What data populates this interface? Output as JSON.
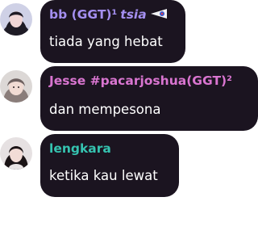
{
  "messages": [
    {
      "name": "bb (GGT)¹",
      "tag": "tsia",
      "name_color": "#a48ff0",
      "text": "tiada yang hebat",
      "flag_icon": "flag-badge-icon"
    },
    {
      "name": "Jesse #pacarjoshua(GGT)²",
      "name_color": "#d975d0",
      "text": "dan mempesona"
    },
    {
      "name": "lengkara",
      "name_color": "#35c3b0",
      "text": "ketika kau lewat"
    }
  ]
}
